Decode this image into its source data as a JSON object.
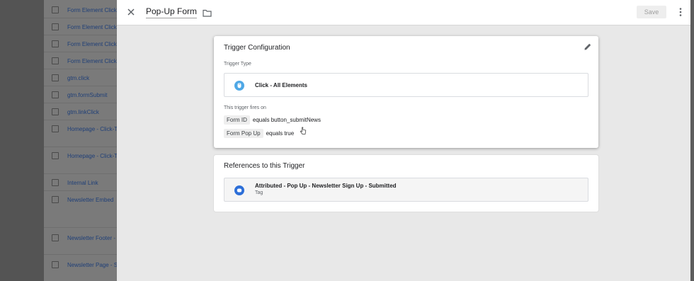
{
  "background_list": {
    "items": [
      {
        "label": "Form Element Click"
      },
      {
        "label": "Form Element Click"
      },
      {
        "label": "Form Element Click"
      },
      {
        "label": "Form Element Click"
      },
      {
        "label": "gtm.click"
      },
      {
        "label": "gtm.formSubmit"
      },
      {
        "label": "gtm.linkClick"
      },
      {
        "label": "Homepage - Click-T"
      },
      {
        "label": "Homepage - Click-T"
      },
      {
        "label": "Internal Link"
      },
      {
        "label": "Newsletter Embed"
      },
      {
        "label": "Newsletter Footer -"
      },
      {
        "label": "Newsletter Page - S"
      }
    ]
  },
  "header": {
    "title": "Pop-Up Form",
    "save_label": "Save",
    "icons": {
      "close": "close-icon",
      "folder": "folder-icon",
      "more": "more-vert-icon"
    }
  },
  "trigger_config": {
    "title": "Trigger Configuration",
    "type_label": "Trigger Type",
    "type_name": "Click - All Elements",
    "fires_on_label": "This trigger fires on",
    "conditions": [
      {
        "variable": "Form ID",
        "rule": "equals button_submitNews"
      },
      {
        "variable": "Form Pop Up",
        "rule": "equals true"
      }
    ]
  },
  "references": {
    "title": "References to this Trigger",
    "items": [
      {
        "name": "Attributed - Pop Up - Newsletter Sign Up - Submitted",
        "type": "Tag"
      }
    ]
  },
  "colors": {
    "accent": "#2d6fd8",
    "trigger_icon": "#4fa8e6",
    "link": "#1f3f78"
  }
}
